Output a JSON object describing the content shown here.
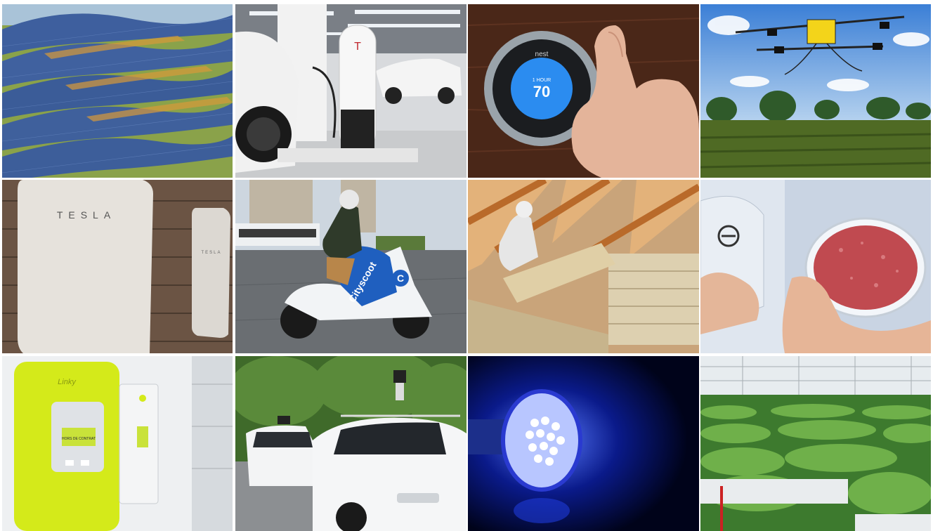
{
  "tiles": [
    {
      "subject": "solar-farm"
    },
    {
      "subject": "ev-charger",
      "brand_text": "T"
    },
    {
      "subject": "smart-thermostat",
      "brand_text": "nest",
      "mode_text": "1 HOUR",
      "temperature_text": "70"
    },
    {
      "subject": "agricultural-drone"
    },
    {
      "subject": "home-battery",
      "brand_text_large": "TESLA",
      "brand_text_small": "TESLA"
    },
    {
      "subject": "electric-scooter",
      "brand_text": "Cityscoot",
      "badge_text": "C"
    },
    {
      "subject": "attic-insulation"
    },
    {
      "subject": "lab-grown-meat"
    },
    {
      "subject": "smart-meter",
      "brand_text": "Linky",
      "display_text": "HORS DE CONTRAT"
    },
    {
      "subject": "self-driving-car"
    },
    {
      "subject": "led-bulb"
    },
    {
      "subject": "greenhouse-lettuce"
    }
  ],
  "colors": {
    "sky": "#5b9be0",
    "solar_blue": "#3d5e9c",
    "grass": "#7a9a3a",
    "nest_blue": "#2b8cf0",
    "linky_green": "#d4ea1a",
    "cityscoot_blue": "#1f5fbf",
    "led_blue": "#1a3cff",
    "wood": "#5a3020",
    "meat": "#c04a50"
  }
}
